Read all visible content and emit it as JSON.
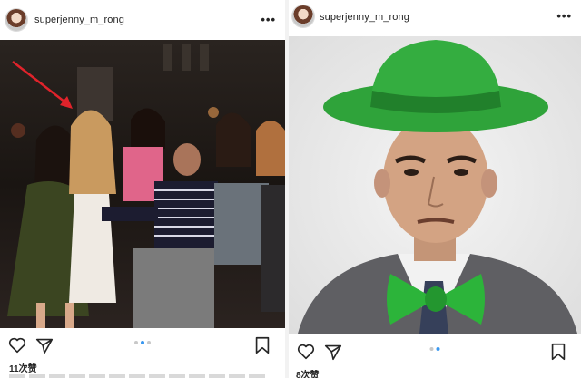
{
  "posts": [
    {
      "username": "superjenny_m_rong",
      "more": "•••",
      "likes": "11次赞",
      "carousel": {
        "count": 3,
        "active": 1
      }
    },
    {
      "username": "superjenny_m_rong",
      "more": "•••",
      "likes": "8次赞",
      "carousel": {
        "count": 2,
        "active": 1
      }
    }
  ],
  "colors": {
    "hat_green": "#2fa33a",
    "bowtie_green": "#2cb43a",
    "arrow_red": "#e0232b",
    "carousel_active": "#3897f0"
  },
  "icons": [
    "heart-icon",
    "send-icon",
    "bookmark-icon",
    "more-options-icon"
  ]
}
